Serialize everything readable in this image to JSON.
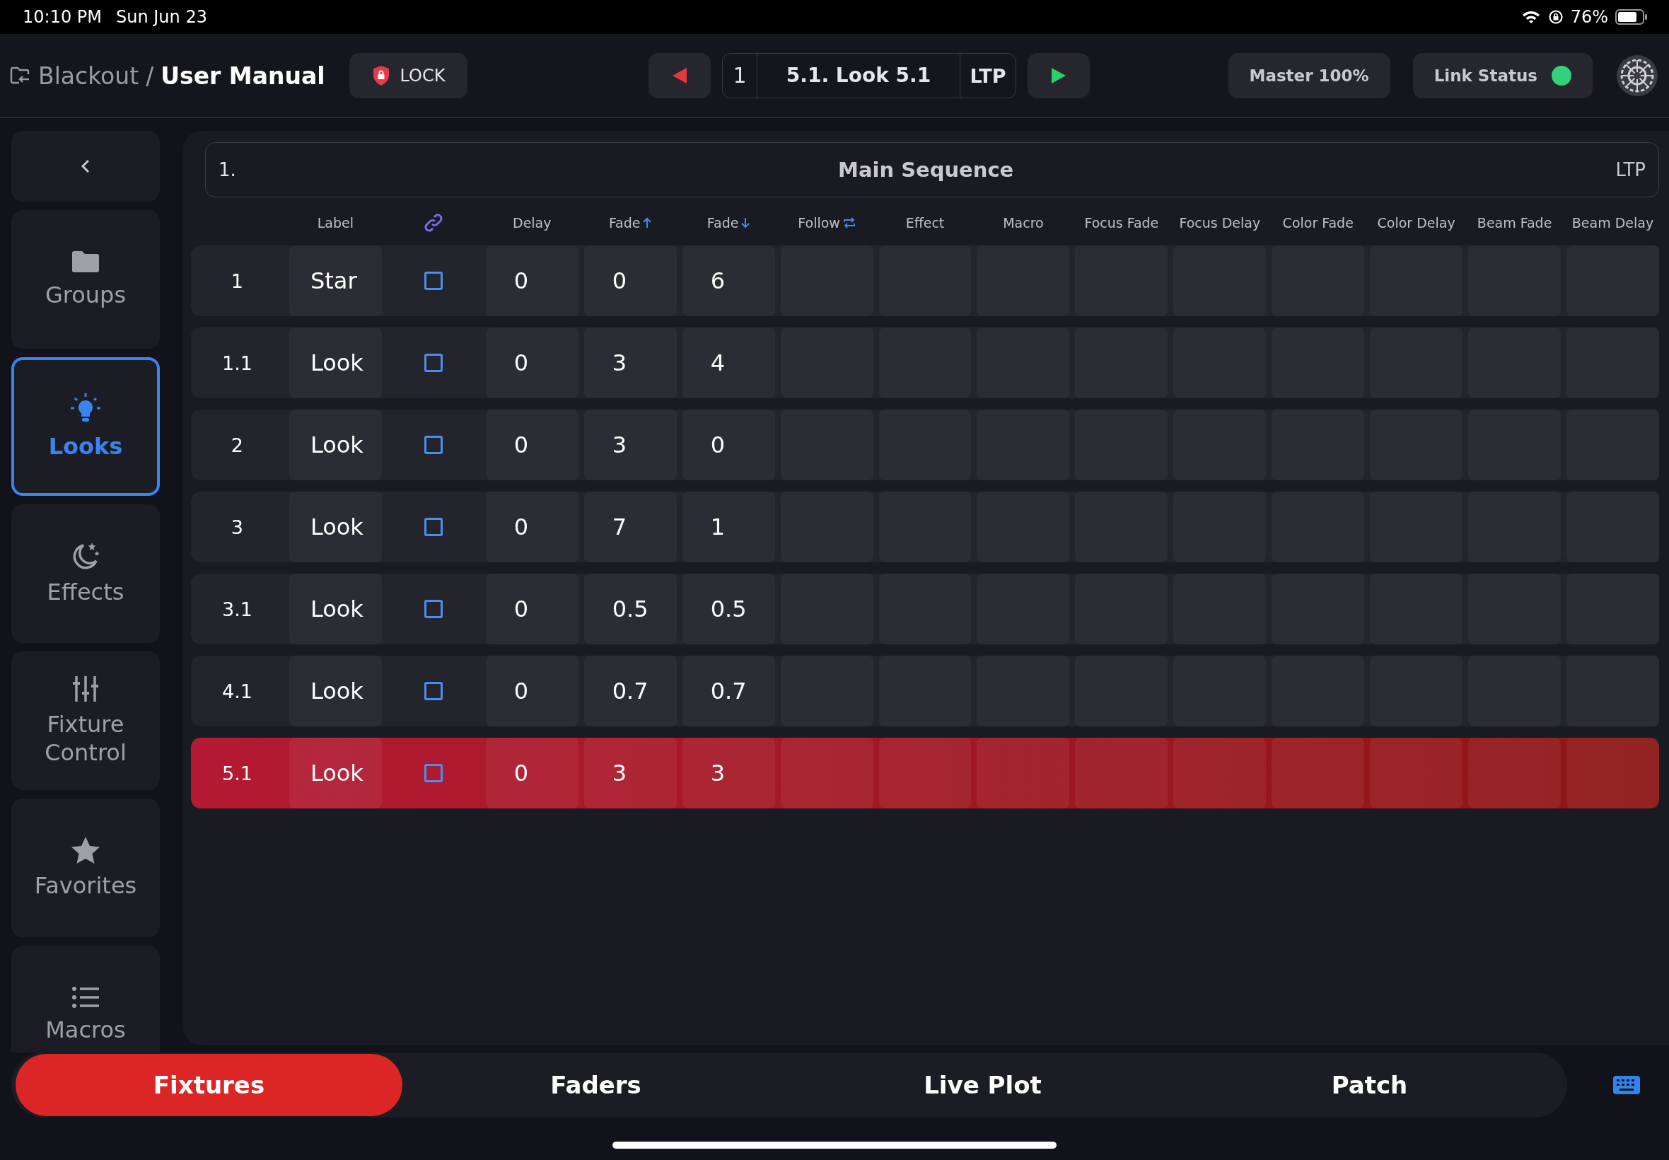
{
  "status_bar": {
    "time": "10:10 PM",
    "date": "Sun Jun 23",
    "battery": "76%"
  },
  "top_bar": {
    "project": "Blackout",
    "separator": "/",
    "title": "User Manual",
    "lock_label": "LOCK",
    "cue_number": "1",
    "cue_name": "5.1. Look 5.1",
    "cue_mode": "LTP",
    "master": "Master 100%",
    "link_status": "Link Status",
    "link_ok": true
  },
  "sidebar": {
    "items": [
      {
        "label": "Groups",
        "kind": "folder",
        "selected": false
      },
      {
        "label": "Looks",
        "kind": "bulb",
        "selected": true
      },
      {
        "label": "Effects",
        "kind": "moon",
        "selected": false
      },
      {
        "label": "Fixture Control",
        "kind": "sliders",
        "selected": false
      },
      {
        "label": "Favorites",
        "kind": "star",
        "selected": false
      },
      {
        "label": "Macros",
        "kind": "list",
        "selected": false
      }
    ]
  },
  "sequence": {
    "number": "1.",
    "title": "Main Sequence",
    "mode": "LTP"
  },
  "table": {
    "columns": [
      {
        "label": "Label",
        "kind": "plain"
      },
      {
        "kind": "link"
      },
      {
        "label": "Delay",
        "kind": "plain"
      },
      {
        "label": "Fade",
        "kind": "up"
      },
      {
        "label": "Fade",
        "kind": "down"
      },
      {
        "label": "Follow",
        "kind": "repeat"
      },
      {
        "label": "Effect",
        "kind": "plain"
      },
      {
        "label": "Macro",
        "kind": "plain"
      },
      {
        "label": "Focus Fade",
        "kind": "plain"
      },
      {
        "label": "Focus Delay",
        "kind": "plain"
      },
      {
        "label": "Color Fade",
        "kind": "plain"
      },
      {
        "label": "Color Delay",
        "kind": "plain"
      },
      {
        "label": "Beam Fade",
        "kind": "plain"
      },
      {
        "label": "Beam Delay",
        "kind": "plain"
      }
    ],
    "rows": [
      {
        "number": "1",
        "label": "Star",
        "checked": false,
        "delay": "0",
        "fade_up": "0",
        "fade_down": "6",
        "selected": false
      },
      {
        "number": "1.1",
        "label": "Look",
        "checked": false,
        "delay": "0",
        "fade_up": "3",
        "fade_down": "4",
        "selected": false
      },
      {
        "number": "2",
        "label": "Look",
        "checked": false,
        "delay": "0",
        "fade_up": "3",
        "fade_down": "0",
        "selected": false
      },
      {
        "number": "3",
        "label": "Look",
        "checked": false,
        "delay": "0",
        "fade_up": "7",
        "fade_down": "1",
        "selected": false
      },
      {
        "number": "3.1",
        "label": "Look",
        "checked": false,
        "delay": "0",
        "fade_up": "0.5",
        "fade_down": "0.5",
        "selected": false
      },
      {
        "number": "4.1",
        "label": "Look",
        "checked": false,
        "delay": "0",
        "fade_up": "0.7",
        "fade_down": "0.7",
        "selected": false
      },
      {
        "number": "5.1",
        "label": "Look",
        "checked": false,
        "delay": "0",
        "fade_up": "3",
        "fade_down": "3",
        "selected": true
      }
    ]
  },
  "bottom_tabs": [
    {
      "label": "Fixtures",
      "selected": true
    },
    {
      "label": "Faders",
      "selected": false
    },
    {
      "label": "Live Plot",
      "selected": false
    },
    {
      "label": "Patch",
      "selected": false
    }
  ]
}
